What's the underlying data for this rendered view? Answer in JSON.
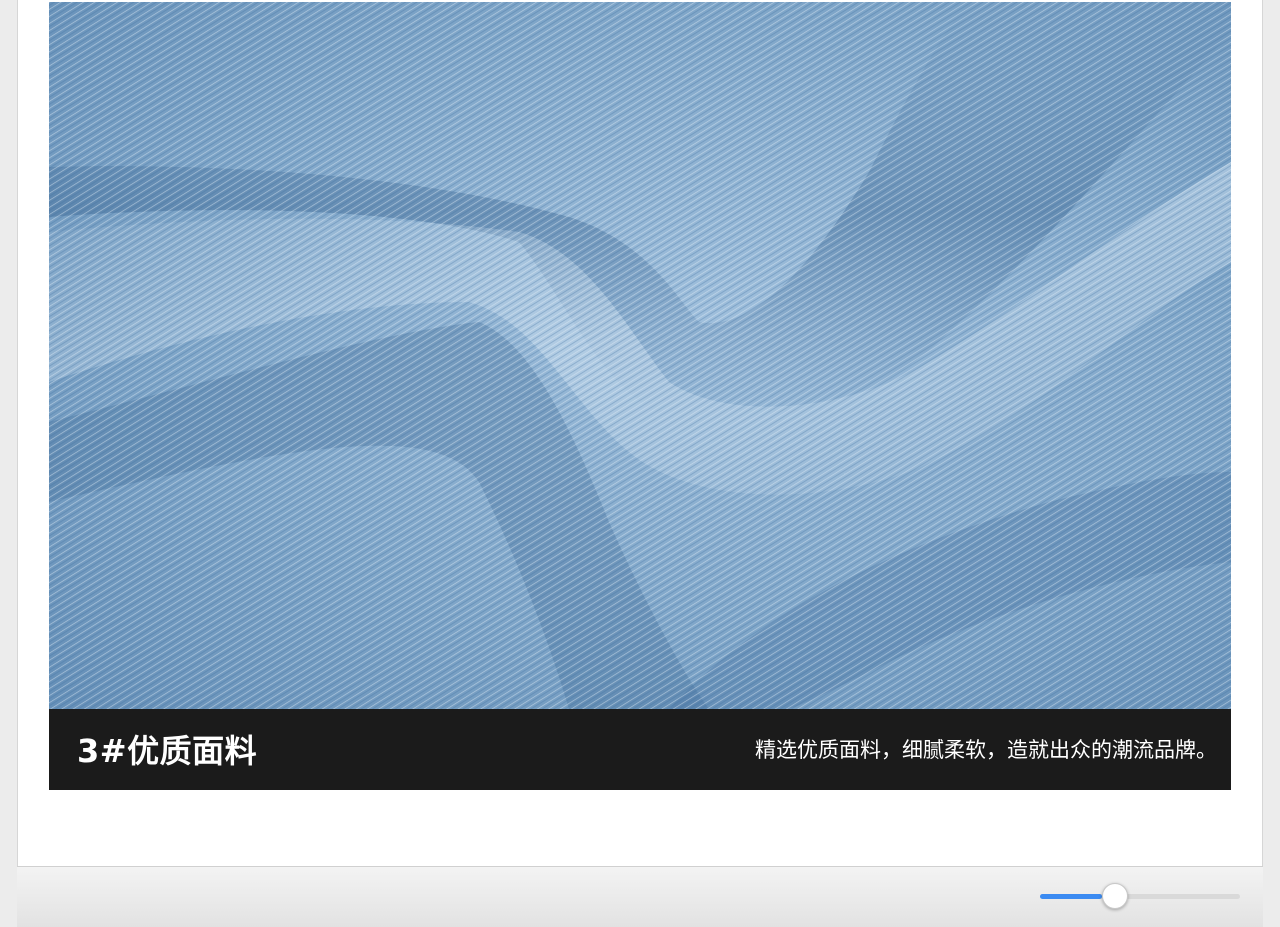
{
  "product_image": {
    "icon": "denim-fabric-photo"
  },
  "caption": {
    "title": "3#优质面料",
    "subtitle": "精选优质面料，细腻柔软，造就出众的潮流品牌。"
  },
  "zoom_slider": {
    "value": 0.31
  },
  "colors": {
    "caption_bg": "#1b1b1b",
    "slider_accent": "#3b8bf2",
    "denim": "#7fa6c9"
  }
}
